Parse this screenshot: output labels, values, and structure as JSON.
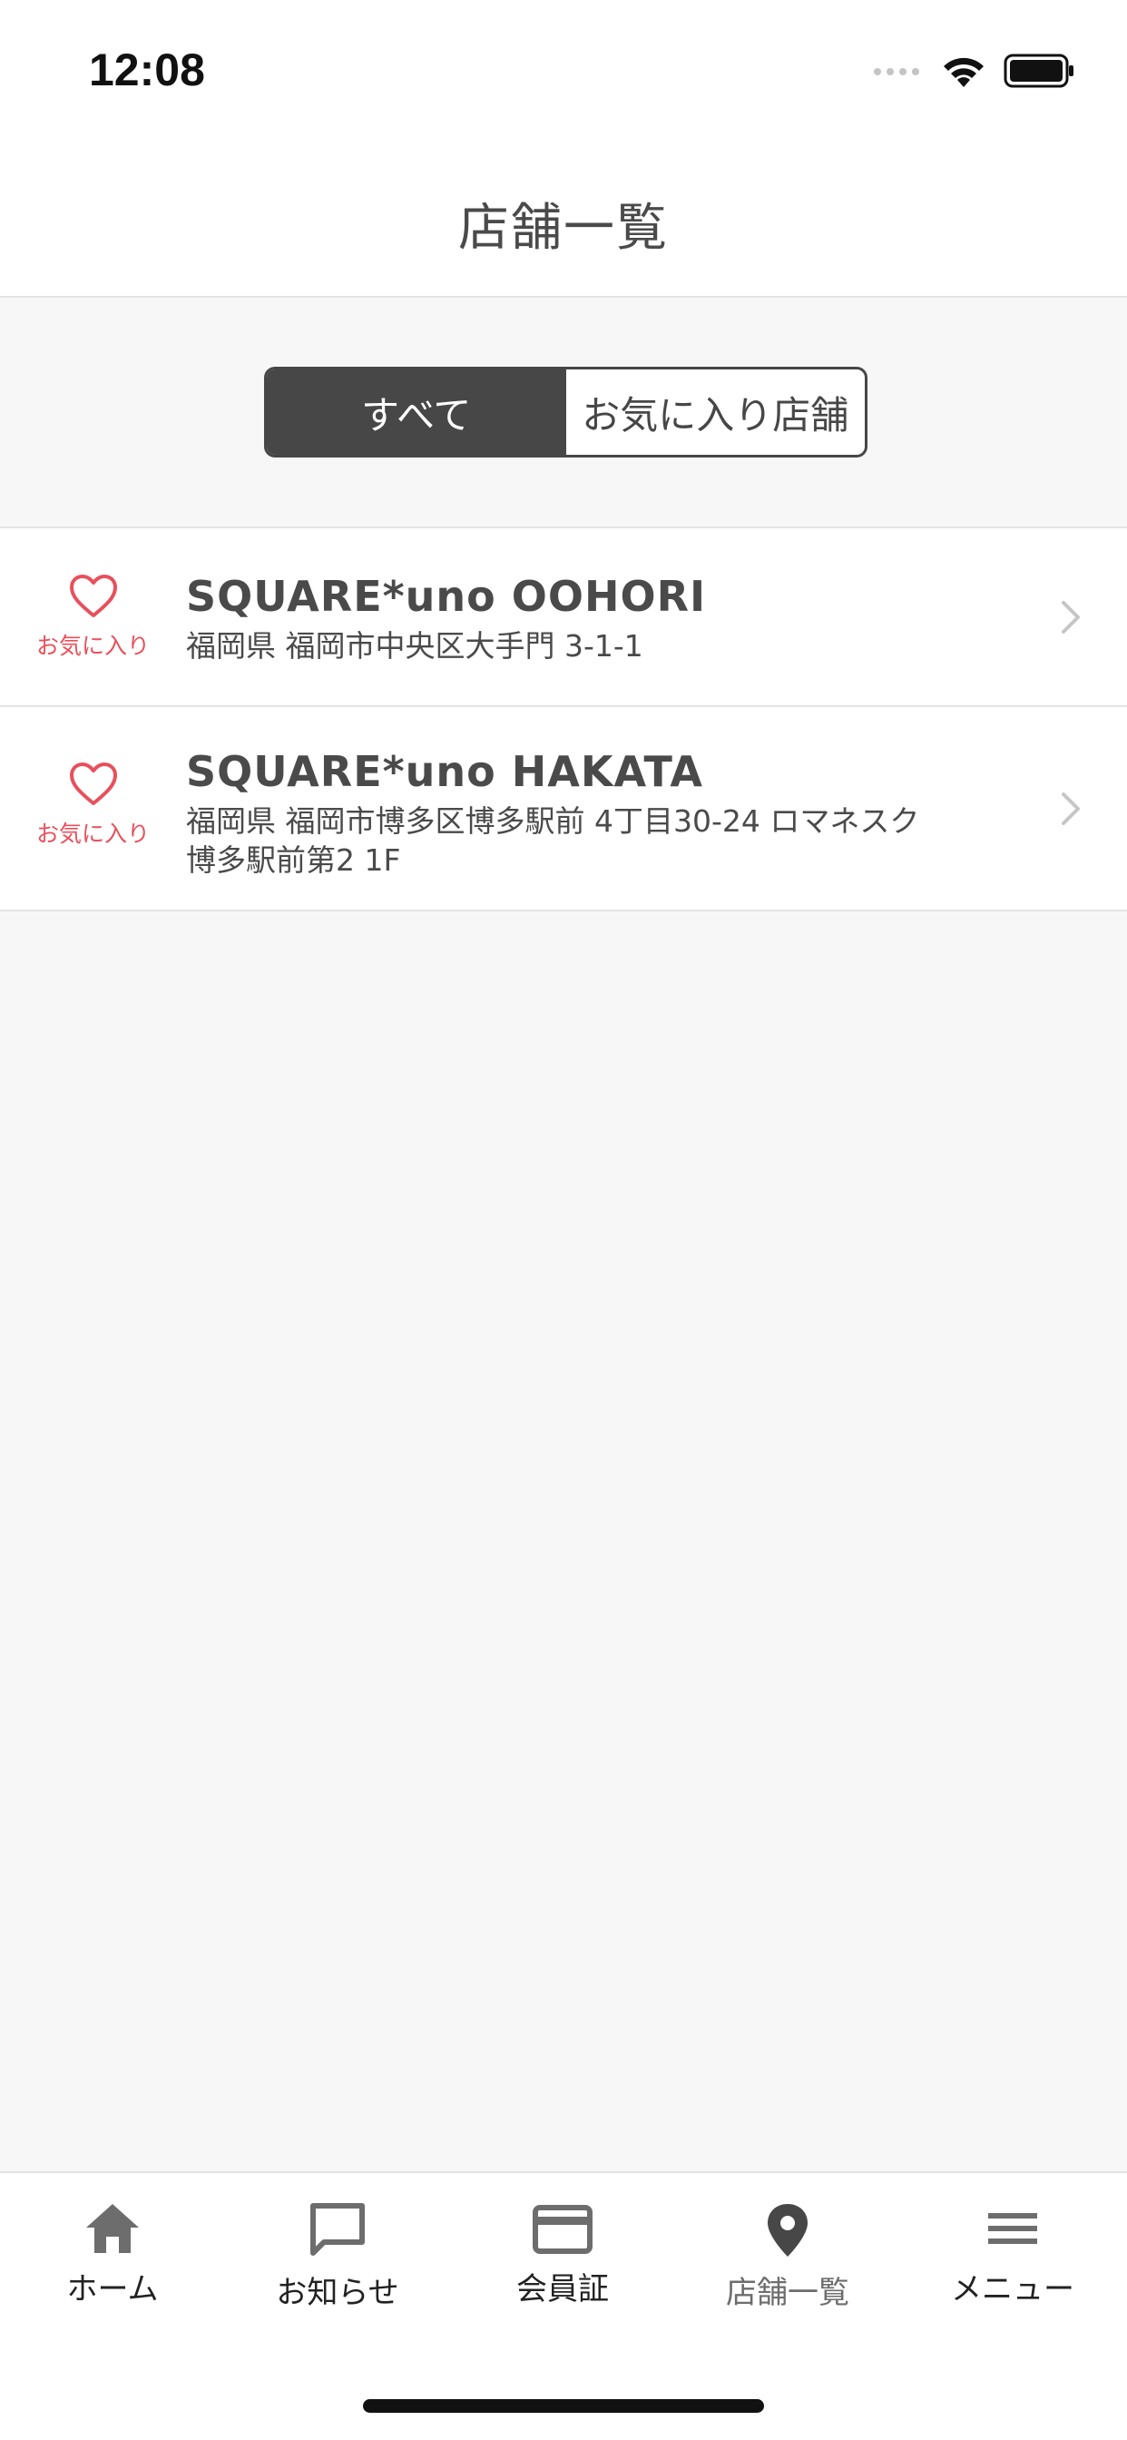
{
  "status_bar": {
    "time": "12:08"
  },
  "header": {
    "title": "店舗一覧"
  },
  "segment": {
    "options": [
      {
        "label": "すべて",
        "selected": true
      },
      {
        "label": "お気に入り店舗",
        "selected": false
      }
    ]
  },
  "stores": [
    {
      "favorite_label": "お気に入り",
      "name": "SQUARE*uno OOHORI",
      "address": "福岡県 福岡市中央区大手門 3-1-1"
    },
    {
      "favorite_label": "お気に入り",
      "name": "SQUARE*uno HAKATA",
      "address": "福岡県 福岡市博多区博多駅前 4丁目30-24 ロマネスク博多駅前第2 1F"
    }
  ],
  "tab_bar": {
    "items": [
      {
        "label": "ホーム",
        "icon": "home-icon"
      },
      {
        "label": "お知らせ",
        "icon": "message-icon"
      },
      {
        "label": "会員証",
        "icon": "card-icon"
      },
      {
        "label": "店舗一覧",
        "icon": "location-pin-icon",
        "active": true
      },
      {
        "label": "メニュー",
        "icon": "menu-icon"
      }
    ]
  },
  "colors": {
    "accent": "#e8505b",
    "dark": "#474747",
    "background": "#f7f7f7"
  }
}
